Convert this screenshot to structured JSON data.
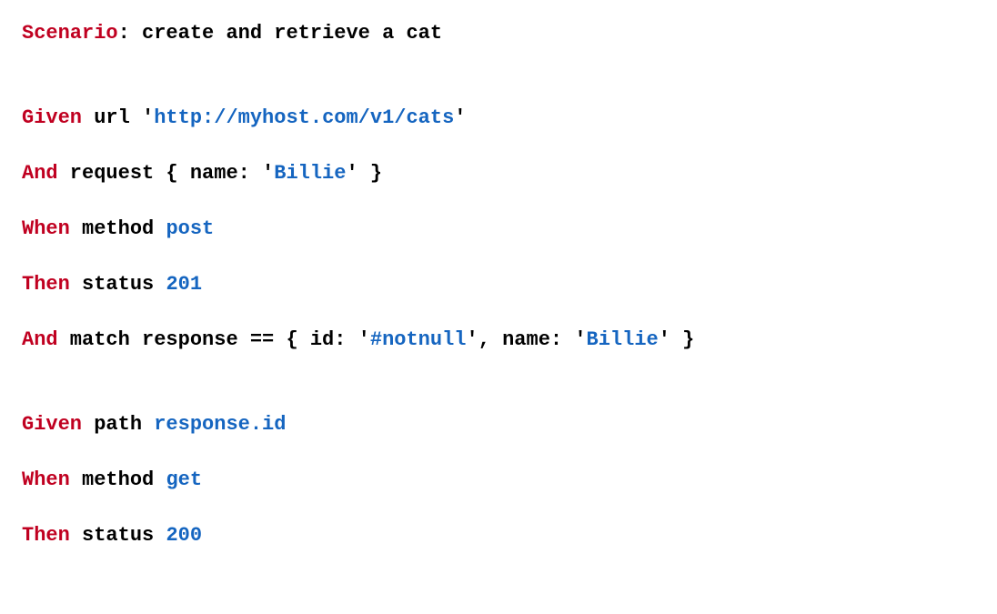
{
  "colors": {
    "keyword": "#c00020",
    "string": "#1565c0",
    "text": "#000000",
    "background": "#ffffff"
  },
  "code": {
    "lines": [
      {
        "tokens": [
          {
            "cls": "kw",
            "text": "Scenario"
          },
          {
            "cls": "txt",
            "text": ": create and retrieve a cat"
          }
        ],
        "spacing": "gap"
      },
      {
        "tokens": [
          {
            "cls": "kw",
            "text": "Given"
          },
          {
            "cls": "txt",
            "text": " url '"
          },
          {
            "cls": "str",
            "text": "http://myhost.com/v1/cats"
          },
          {
            "cls": "txt",
            "text": "'"
          }
        ]
      },
      {
        "tokens": [
          {
            "cls": "kw",
            "text": "And"
          },
          {
            "cls": "txt",
            "text": " request { name: '"
          },
          {
            "cls": "str",
            "text": "Billie"
          },
          {
            "cls": "txt",
            "text": "' }"
          }
        ]
      },
      {
        "tokens": [
          {
            "cls": "kw",
            "text": "When"
          },
          {
            "cls": "txt",
            "text": " method "
          },
          {
            "cls": "val",
            "text": "post"
          }
        ]
      },
      {
        "tokens": [
          {
            "cls": "kw",
            "text": "Then"
          },
          {
            "cls": "txt",
            "text": " status "
          },
          {
            "cls": "val",
            "text": "201"
          }
        ]
      },
      {
        "tokens": [
          {
            "cls": "kw",
            "text": "And"
          },
          {
            "cls": "txt",
            "text": " match response == { id: '"
          },
          {
            "cls": "str",
            "text": "#notnull"
          },
          {
            "cls": "txt",
            "text": "', name: '"
          },
          {
            "cls": "str",
            "text": "Billie"
          },
          {
            "cls": "txt",
            "text": "' }"
          }
        ],
        "spacing": "gap"
      },
      {
        "tokens": [
          {
            "cls": "kw",
            "text": "Given"
          },
          {
            "cls": "txt",
            "text": " path "
          },
          {
            "cls": "val",
            "text": "response.id"
          }
        ]
      },
      {
        "tokens": [
          {
            "cls": "kw",
            "text": "When"
          },
          {
            "cls": "txt",
            "text": " method "
          },
          {
            "cls": "val",
            "text": "get"
          }
        ]
      },
      {
        "tokens": [
          {
            "cls": "kw",
            "text": "Then"
          },
          {
            "cls": "txt",
            "text": " status "
          },
          {
            "cls": "val",
            "text": "200"
          }
        ],
        "spacing": "last"
      }
    ]
  }
}
